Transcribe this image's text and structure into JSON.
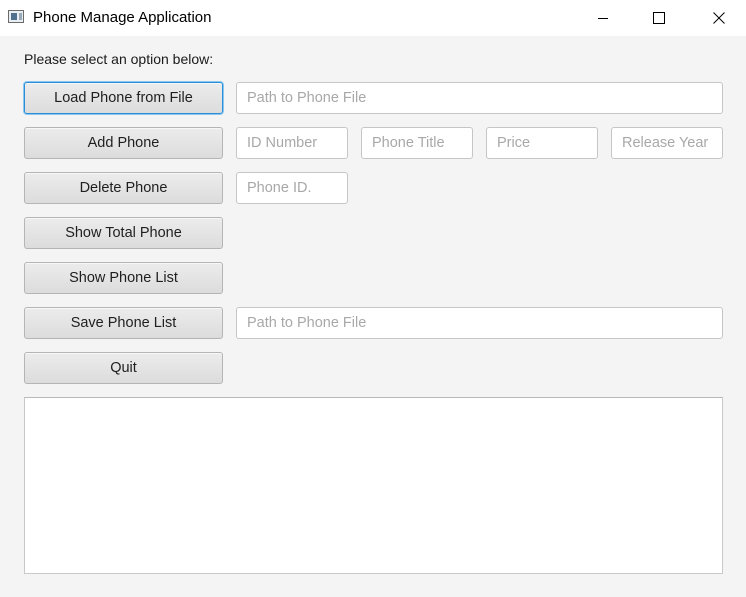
{
  "window": {
    "title": "Phone Manage Application",
    "icon": "application-window-icon",
    "controls": [
      "minimize-icon",
      "maximize-icon",
      "close-icon"
    ]
  },
  "prompt": "Please select an option below:",
  "buttons": {
    "load": "Load Phone from File",
    "add": "Add Phone",
    "delete": "Delete Phone",
    "total": "Show Total Phone",
    "list": "Show Phone List",
    "save": "Save Phone List",
    "quit": "Quit"
  },
  "fields": {
    "load_path": {
      "placeholder": "Path to Phone File",
      "value": ""
    },
    "id_number": {
      "placeholder": "ID Number",
      "value": ""
    },
    "phone_title": {
      "placeholder": "Phone Title",
      "value": ""
    },
    "price": {
      "placeholder": "Price",
      "value": ""
    },
    "release_year": {
      "placeholder": "Release Year",
      "value": ""
    },
    "delete_id": {
      "placeholder": "Phone ID.",
      "value": ""
    },
    "save_path": {
      "placeholder": "Path to Phone File",
      "value": ""
    }
  },
  "output": {
    "value": ""
  },
  "colors": {
    "focus_border": "#2a8fd6",
    "background": "#f4f4f4",
    "titlebar": "#ffffff"
  }
}
